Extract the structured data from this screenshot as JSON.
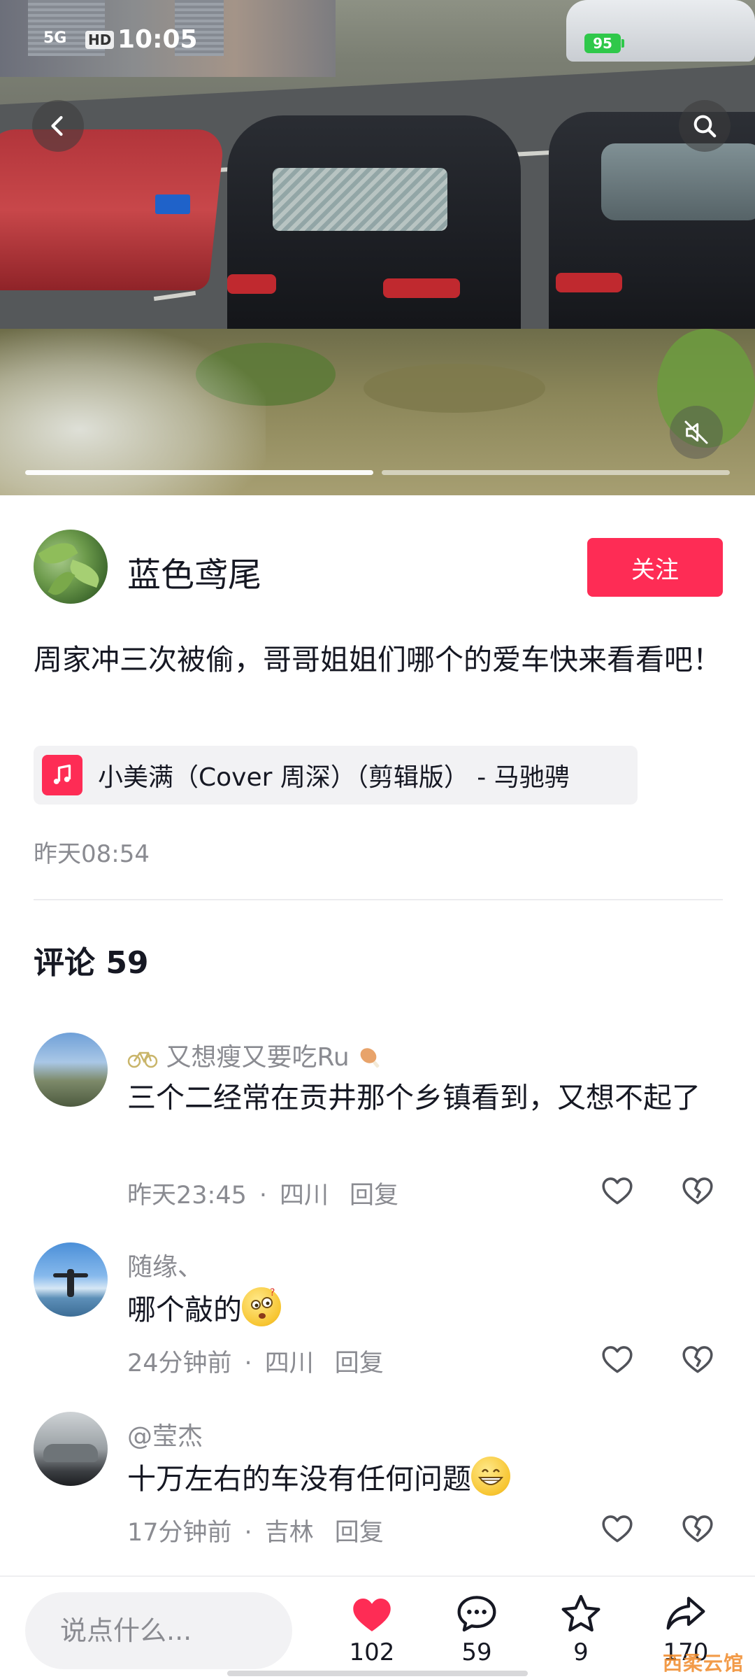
{
  "status": {
    "network": "5G",
    "hd": "HD",
    "time": "10:05",
    "battery": "95"
  },
  "colors": {
    "accent": "#fe2c55",
    "secondary_text": "#8a8b91",
    "primary_text": "#161823"
  },
  "post": {
    "author": "蓝色鸢尾",
    "follow_label": "关注",
    "caption": "周家冲三次被偷，哥哥姐姐们哪个的爱车快来看看吧！",
    "music": "小美满（Cover 周深）（剪辑版） - 马驰骋",
    "time": "昨天08:54",
    "image_count": 2,
    "current_image": 1
  },
  "comments_section": {
    "title": "评论 59",
    "items": [
      {
        "user": "又想瘦又要吃Ru",
        "text": "三个二经常在贡井那个乡镇看到，又想不起了",
        "time": "昨天23:45",
        "location": "四川",
        "reply_label": "回复"
      },
      {
        "user": "随缘、",
        "text": "哪个敲的",
        "time": "24分钟前",
        "location": "四川",
        "reply_label": "回复"
      },
      {
        "user": "@莹杰",
        "text": "十万左右的车没有任何问题",
        "time": "17分钟前",
        "location": "吉林",
        "reply_label": "回复"
      }
    ]
  },
  "bottom_bar": {
    "input_placeholder": "说点什么...",
    "likes": "102",
    "comments": "59",
    "favorites": "9",
    "shares": "170"
  },
  "watermark": "西柔云馆"
}
